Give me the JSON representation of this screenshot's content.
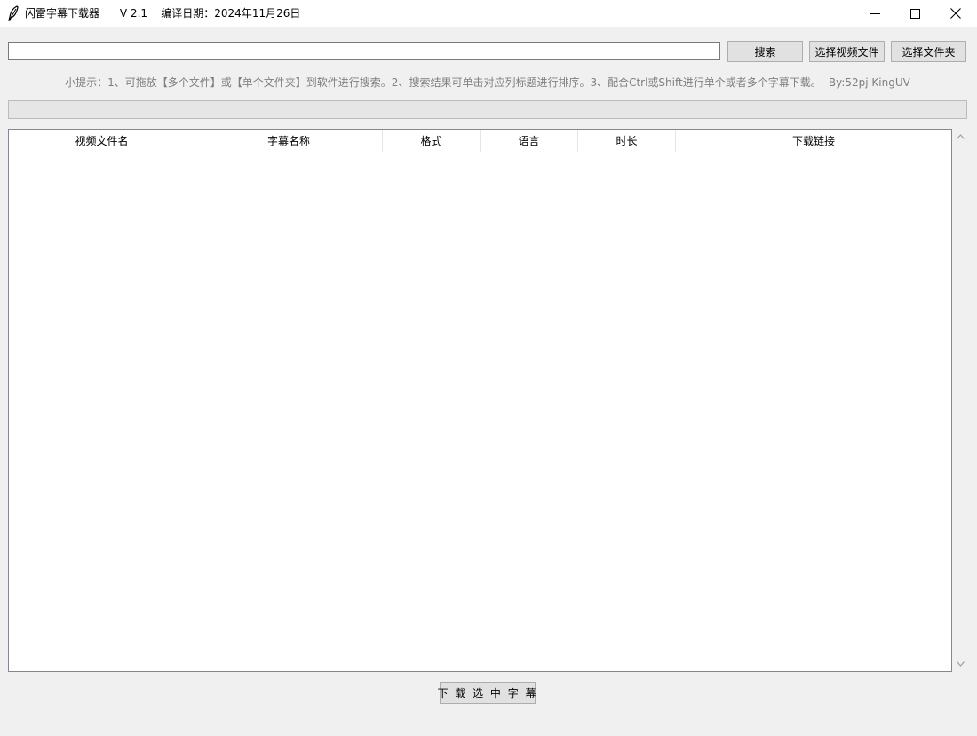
{
  "window": {
    "app_name": "闪雷字幕下载器",
    "version": "V 2.1",
    "build_date": "编译日期：2024年11月26日"
  },
  "search": {
    "value": "",
    "placeholder": "",
    "search_label": "搜索",
    "select_video_label": "选择视频文件",
    "select_folder_label": "选择文件夹"
  },
  "hint": "小提示：1、可拖放【多个文件】或【单个文件夹】到软件进行搜索。2、搜索结果可单击对应列标题进行排序。3、配合Ctrl或Shift进行单个或者多个字幕下载。 -By:52pj KingUV",
  "progress": {
    "value": 0
  },
  "table": {
    "columns": [
      "视频文件名",
      "字幕名称",
      "格式",
      "语言",
      "时长",
      "下载链接"
    ],
    "rows": []
  },
  "download_label": "下 载 选 中 字 幕",
  "colors": {
    "window_bg": "#f0f0f0",
    "button_bg": "#e1e1e1",
    "hint_text": "#7f7f7f"
  },
  "icons": [
    "feather-icon",
    "minimize-icon",
    "maximize-icon",
    "close-icon",
    "scroll-up-icon",
    "scroll-down-icon"
  ]
}
